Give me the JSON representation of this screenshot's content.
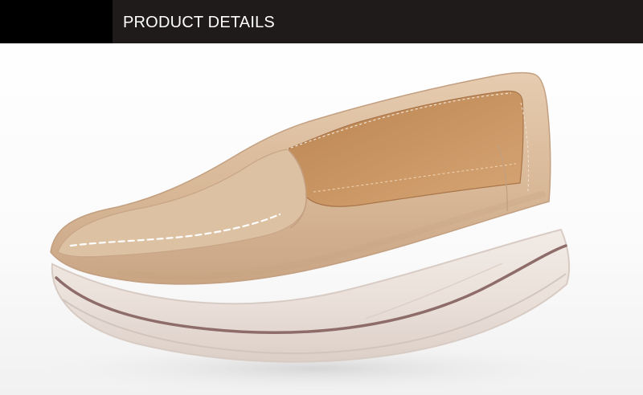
{
  "header": {
    "title": "PRODUCT DETAILS",
    "background_color": "#1f1b1a",
    "accent_color": "#000000",
    "text_color": "#ffffff"
  },
  "photo": {
    "subject": "shoe",
    "colors": {
      "upper": "#d7b89a",
      "lining": "#c99663",
      "sole": "#ebe1db",
      "stripe": "#8d6c69",
      "stitching": "#ffffff"
    }
  }
}
